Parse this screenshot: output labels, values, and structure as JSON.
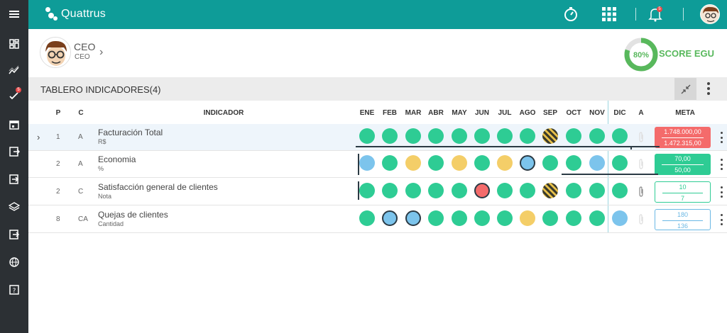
{
  "app": {
    "name": "Quattrus"
  },
  "user": {
    "title": "CEO",
    "subtitle": "CEO"
  },
  "score": {
    "value": "80%",
    "label": "SCORE EGU",
    "percent": 80
  },
  "topbar": {
    "notification_count": "5"
  },
  "sidebar": {
    "badge": "5"
  },
  "panel": {
    "title": "TABLERO INDICADORES(4)"
  },
  "columns": {
    "p": "P",
    "c": "C",
    "indicador": "INDICADOR",
    "a": "A",
    "meta": "META",
    "months": [
      "ENE",
      "FEB",
      "MAR",
      "ABR",
      "MAY",
      "JUN",
      "JUL",
      "AGO",
      "SEP",
      "OCT",
      "NOV",
      "DIC"
    ]
  },
  "rows": [
    {
      "p": "1",
      "c": "A",
      "name": "Facturación Total",
      "unit": "R$",
      "meta1": "1.748.000,00",
      "meta2": "1.472.315,00",
      "dots": [
        "g",
        "g",
        "g",
        "g",
        "g",
        "g",
        "g",
        "g",
        "stripe",
        "g",
        "g",
        "g"
      ]
    },
    {
      "p": "2",
      "c": "A",
      "name": "Economia",
      "unit": "%",
      "meta1": "70,00",
      "meta2": "50,00",
      "dots": [
        "b",
        "g",
        "y",
        "g",
        "y",
        "g",
        "y",
        "bbd",
        "g",
        "g",
        "b",
        "g"
      ]
    },
    {
      "p": "2",
      "c": "C",
      "name": "Satisfacción general de clientes",
      "unit": "Nota",
      "meta1": "10",
      "meta2": "7",
      "dots": [
        "g",
        "g",
        "g",
        "g",
        "g",
        "rbd",
        "g",
        "g",
        "stripe",
        "g",
        "g",
        "g"
      ]
    },
    {
      "p": "8",
      "c": "CA",
      "name": "Quejas de clientes",
      "unit": "Cantidad",
      "meta1": "180",
      "meta2": "136",
      "dots": [
        "g",
        "bbd",
        "bbd",
        "g",
        "g",
        "g",
        "g",
        "y",
        "g",
        "g",
        "g",
        "b"
      ]
    }
  ],
  "colors": {
    "teal": "#0e9c98",
    "sidebar": "#2c3034",
    "green": "#2ecc94",
    "red": "#f46b6b",
    "blue": "#7cc4ec",
    "yellow": "#f4ce68",
    "score": "#58b85c"
  }
}
